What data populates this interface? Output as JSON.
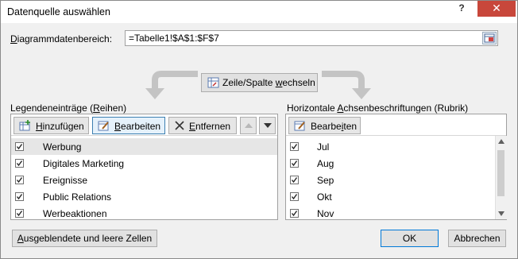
{
  "window": {
    "title": "Datenquelle auswählen",
    "help": "?",
    "close": "✕"
  },
  "range": {
    "label_pre": "",
    "label_u": "D",
    "label_post": "iagrammdatenbereich:",
    "value": "=Tabelle1!$A$1:$F$7"
  },
  "swap": {
    "label_pre": "Zeile/Spalte ",
    "label_u": "w",
    "label_post": "echseln"
  },
  "legend": {
    "title_pre": "Legendeneinträge (",
    "title_u": "R",
    "title_post": "eihen)",
    "add": {
      "pre": "",
      "u": "H",
      "post": "inzufügen"
    },
    "edit": {
      "pre": "",
      "u": "B",
      "post": "earbeiten"
    },
    "remove": {
      "pre": "",
      "u": "E",
      "post": "ntfernen"
    },
    "items": [
      "Werbung",
      "Digitales Marketing",
      "Ereignisse",
      "Public Relations",
      "Werbeaktionen"
    ]
  },
  "axis": {
    "title_pre": "Horizontale ",
    "title_u": "A",
    "title_post": "chsenbeschriftungen (Rubrik)",
    "edit": {
      "pre": "Bearbe",
      "u": "i",
      "post": "ten"
    },
    "items": [
      "Jul",
      "Aug",
      "Sep",
      "Okt",
      "Nov"
    ]
  },
  "footer": {
    "hidden_pre": "",
    "hidden_u": "A",
    "hidden_post": "usgeblendete und leere Zellen",
    "ok": "OK",
    "cancel": "Abbrechen"
  },
  "colors": {
    "close": "#c8473b",
    "accent": "#0078d7"
  }
}
